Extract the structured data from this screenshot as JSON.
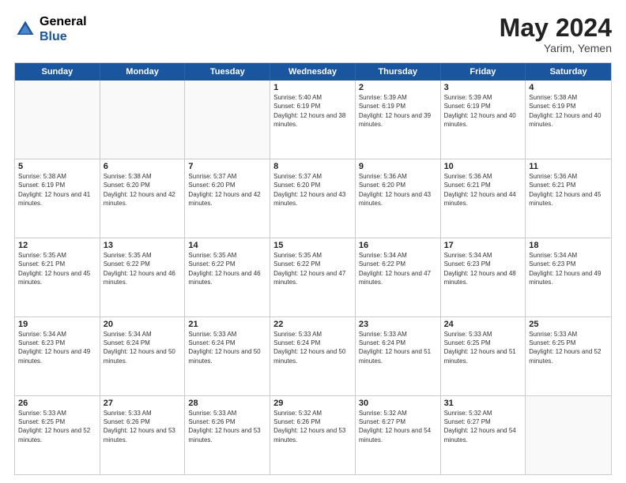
{
  "header": {
    "logo": {
      "general": "General",
      "blue": "Blue"
    },
    "month_year": "May 2024",
    "location": "Yarim, Yemen"
  },
  "weekdays": [
    "Sunday",
    "Monday",
    "Tuesday",
    "Wednesday",
    "Thursday",
    "Friday",
    "Saturday"
  ],
  "weeks": [
    [
      {
        "day": "",
        "empty": true
      },
      {
        "day": "",
        "empty": true
      },
      {
        "day": "",
        "empty": true
      },
      {
        "day": "1",
        "sunrise": "Sunrise: 5:40 AM",
        "sunset": "Sunset: 6:19 PM",
        "daylight": "Daylight: 12 hours and 38 minutes."
      },
      {
        "day": "2",
        "sunrise": "Sunrise: 5:39 AM",
        "sunset": "Sunset: 6:19 PM",
        "daylight": "Daylight: 12 hours and 39 minutes."
      },
      {
        "day": "3",
        "sunrise": "Sunrise: 5:39 AM",
        "sunset": "Sunset: 6:19 PM",
        "daylight": "Daylight: 12 hours and 40 minutes."
      },
      {
        "day": "4",
        "sunrise": "Sunrise: 5:38 AM",
        "sunset": "Sunset: 6:19 PM",
        "daylight": "Daylight: 12 hours and 40 minutes."
      }
    ],
    [
      {
        "day": "5",
        "sunrise": "Sunrise: 5:38 AM",
        "sunset": "Sunset: 6:19 PM",
        "daylight": "Daylight: 12 hours and 41 minutes."
      },
      {
        "day": "6",
        "sunrise": "Sunrise: 5:38 AM",
        "sunset": "Sunset: 6:20 PM",
        "daylight": "Daylight: 12 hours and 42 minutes."
      },
      {
        "day": "7",
        "sunrise": "Sunrise: 5:37 AM",
        "sunset": "Sunset: 6:20 PM",
        "daylight": "Daylight: 12 hours and 42 minutes."
      },
      {
        "day": "8",
        "sunrise": "Sunrise: 5:37 AM",
        "sunset": "Sunset: 6:20 PM",
        "daylight": "Daylight: 12 hours and 43 minutes."
      },
      {
        "day": "9",
        "sunrise": "Sunrise: 5:36 AM",
        "sunset": "Sunset: 6:20 PM",
        "daylight": "Daylight: 12 hours and 43 minutes."
      },
      {
        "day": "10",
        "sunrise": "Sunrise: 5:36 AM",
        "sunset": "Sunset: 6:21 PM",
        "daylight": "Daylight: 12 hours and 44 minutes."
      },
      {
        "day": "11",
        "sunrise": "Sunrise: 5:36 AM",
        "sunset": "Sunset: 6:21 PM",
        "daylight": "Daylight: 12 hours and 45 minutes."
      }
    ],
    [
      {
        "day": "12",
        "sunrise": "Sunrise: 5:35 AM",
        "sunset": "Sunset: 6:21 PM",
        "daylight": "Daylight: 12 hours and 45 minutes."
      },
      {
        "day": "13",
        "sunrise": "Sunrise: 5:35 AM",
        "sunset": "Sunset: 6:22 PM",
        "daylight": "Daylight: 12 hours and 46 minutes."
      },
      {
        "day": "14",
        "sunrise": "Sunrise: 5:35 AM",
        "sunset": "Sunset: 6:22 PM",
        "daylight": "Daylight: 12 hours and 46 minutes."
      },
      {
        "day": "15",
        "sunrise": "Sunrise: 5:35 AM",
        "sunset": "Sunset: 6:22 PM",
        "daylight": "Daylight: 12 hours and 47 minutes."
      },
      {
        "day": "16",
        "sunrise": "Sunrise: 5:34 AM",
        "sunset": "Sunset: 6:22 PM",
        "daylight": "Daylight: 12 hours and 47 minutes."
      },
      {
        "day": "17",
        "sunrise": "Sunrise: 5:34 AM",
        "sunset": "Sunset: 6:23 PM",
        "daylight": "Daylight: 12 hours and 48 minutes."
      },
      {
        "day": "18",
        "sunrise": "Sunrise: 5:34 AM",
        "sunset": "Sunset: 6:23 PM",
        "daylight": "Daylight: 12 hours and 49 minutes."
      }
    ],
    [
      {
        "day": "19",
        "sunrise": "Sunrise: 5:34 AM",
        "sunset": "Sunset: 6:23 PM",
        "daylight": "Daylight: 12 hours and 49 minutes."
      },
      {
        "day": "20",
        "sunrise": "Sunrise: 5:34 AM",
        "sunset": "Sunset: 6:24 PM",
        "daylight": "Daylight: 12 hours and 50 minutes."
      },
      {
        "day": "21",
        "sunrise": "Sunrise: 5:33 AM",
        "sunset": "Sunset: 6:24 PM",
        "daylight": "Daylight: 12 hours and 50 minutes."
      },
      {
        "day": "22",
        "sunrise": "Sunrise: 5:33 AM",
        "sunset": "Sunset: 6:24 PM",
        "daylight": "Daylight: 12 hours and 50 minutes."
      },
      {
        "day": "23",
        "sunrise": "Sunrise: 5:33 AM",
        "sunset": "Sunset: 6:24 PM",
        "daylight": "Daylight: 12 hours and 51 minutes."
      },
      {
        "day": "24",
        "sunrise": "Sunrise: 5:33 AM",
        "sunset": "Sunset: 6:25 PM",
        "daylight": "Daylight: 12 hours and 51 minutes."
      },
      {
        "day": "25",
        "sunrise": "Sunrise: 5:33 AM",
        "sunset": "Sunset: 6:25 PM",
        "daylight": "Daylight: 12 hours and 52 minutes."
      }
    ],
    [
      {
        "day": "26",
        "sunrise": "Sunrise: 5:33 AM",
        "sunset": "Sunset: 6:25 PM",
        "daylight": "Daylight: 12 hours and 52 minutes."
      },
      {
        "day": "27",
        "sunrise": "Sunrise: 5:33 AM",
        "sunset": "Sunset: 6:26 PM",
        "daylight": "Daylight: 12 hours and 53 minutes."
      },
      {
        "day": "28",
        "sunrise": "Sunrise: 5:33 AM",
        "sunset": "Sunset: 6:26 PM",
        "daylight": "Daylight: 12 hours and 53 minutes."
      },
      {
        "day": "29",
        "sunrise": "Sunrise: 5:32 AM",
        "sunset": "Sunset: 6:26 PM",
        "daylight": "Daylight: 12 hours and 53 minutes."
      },
      {
        "day": "30",
        "sunrise": "Sunrise: 5:32 AM",
        "sunset": "Sunset: 6:27 PM",
        "daylight": "Daylight: 12 hours and 54 minutes."
      },
      {
        "day": "31",
        "sunrise": "Sunrise: 5:32 AM",
        "sunset": "Sunset: 6:27 PM",
        "daylight": "Daylight: 12 hours and 54 minutes."
      },
      {
        "day": "",
        "empty": true
      }
    ]
  ]
}
